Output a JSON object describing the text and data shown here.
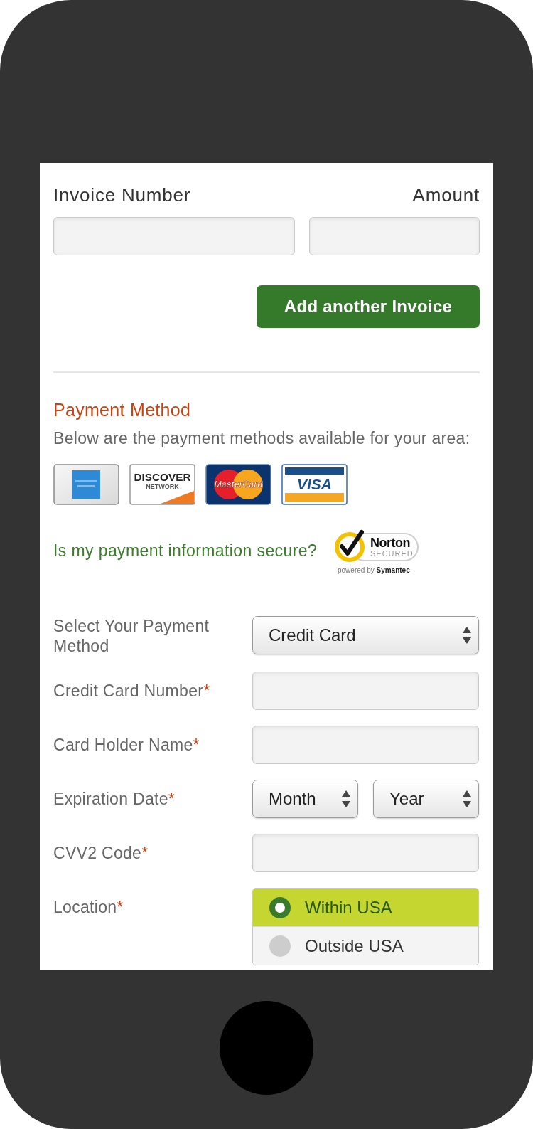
{
  "invoice": {
    "fields": [
      {
        "label": "Invoice Number"
      },
      {
        "label": "Amount"
      }
    ],
    "add_button": "Add another Invoice"
  },
  "payment_method": {
    "title": "Payment Method",
    "description": "Below are the payment methods available for your area:",
    "cards": [
      {
        "kind": "amex"
      },
      {
        "kind": "discover",
        "text": "DISCOVER",
        "subtext": "NETWORK"
      },
      {
        "kind": "mastercard",
        "text": "MasterCard"
      },
      {
        "kind": "visa",
        "text": "VISA"
      }
    ],
    "security_link": "Is my payment information secure?",
    "seal": {
      "title": "Norton",
      "status": "SECURED",
      "footer": "powered by **Symantec**"
    }
  },
  "form": {
    "rows": [
      {
        "kind": "select",
        "label": "Select Your Payment Method",
        "value": "Credit Card"
      },
      {
        "kind": "text",
        "label": "Credit Card Number",
        "required_mark": "*"
      },
      {
        "kind": "text",
        "label": "Card Holder Name",
        "required_mark": "*"
      },
      {
        "kind": "date",
        "label": "Expiration Date",
        "required_mark": "*",
        "selects": [
          {
            "value": "Month"
          },
          {
            "value": "Year"
          }
        ]
      },
      {
        "kind": "text",
        "label": "CVV2 Code",
        "required_mark": "*"
      },
      {
        "kind": "radio",
        "label": "Location",
        "required_mark": "*",
        "options": [
          {
            "label": "Within USA",
            "selected": true
          },
          {
            "label": "Outside USA",
            "selected": false
          }
        ]
      }
    ]
  }
}
